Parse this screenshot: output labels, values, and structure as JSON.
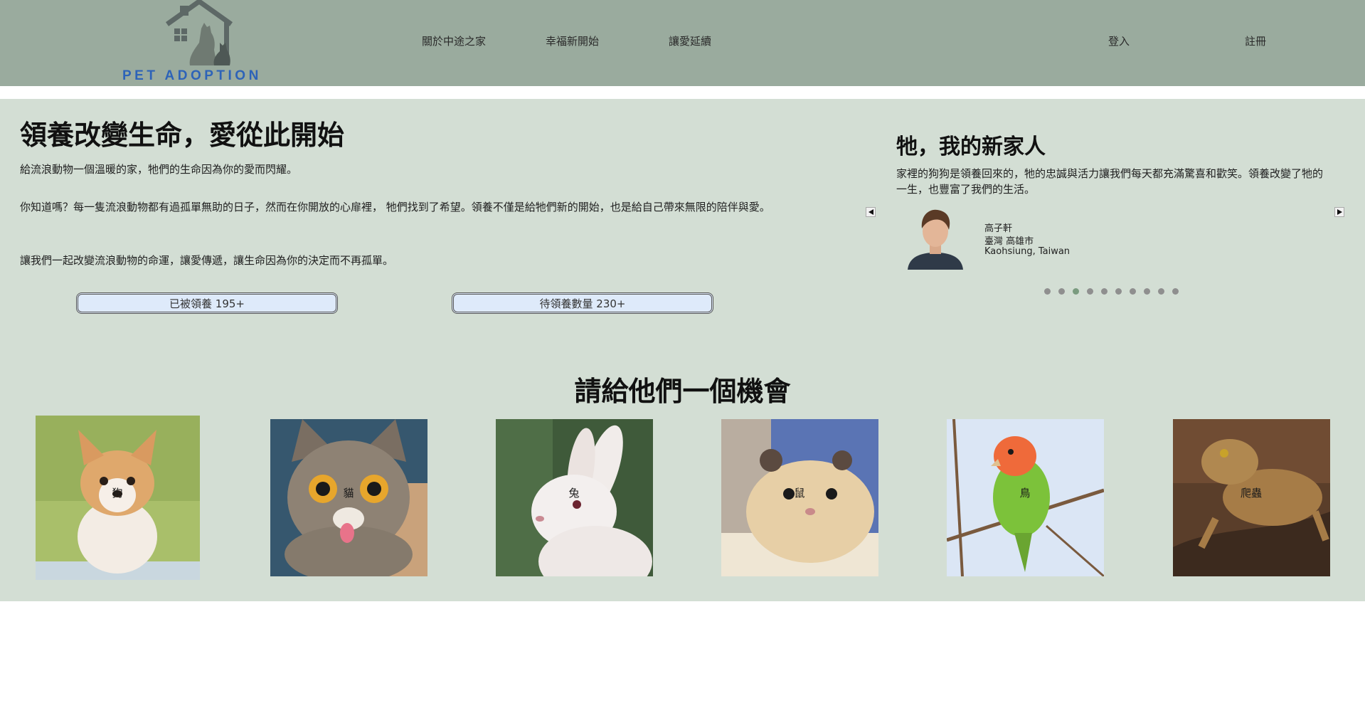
{
  "brand": {
    "logo_text": "PET ADOPTION"
  },
  "nav": {
    "links": [
      "關於中途之家",
      "幸福新開始",
      "讓愛延續"
    ],
    "login": "登入",
    "register": "註冊"
  },
  "hero": {
    "title": "領養改變生命，愛從此開始",
    "p1": "給流浪動物一個溫暖的家，牠們的生命因為你的愛而閃耀。",
    "p2": "你知道嗎？每一隻流浪動物都有過孤單無助的日子，然而在你開放的心扉裡， 牠們找到了希望。領養不僅是給牠們新的開始，也是給自己帶來無限的陪伴與愛。",
    "p3": "讓我們一起改變流浪動物的命運，讓愛傳遞，讓生命因為你的決定而不再孤單。",
    "adopted_label": "已被領養 195+",
    "waiting_label": "待領養數量 230+"
  },
  "testimonial": {
    "title": "牠，我的新家人",
    "text": "家裡的狗狗是領養回來的，牠的忠誠與活力讓我們每天都充滿驚喜和歡笑。領養改變了牠的一生，也豐富了我們的生活。",
    "name": "高子軒",
    "location_zh": "臺灣 高雄市",
    "location_en": "Kaohsiung, Taiwan",
    "dot_count": 10,
    "active_dot": 2
  },
  "animals": {
    "title": "請給他們一個機會",
    "items": [
      {
        "label": "狗"
      },
      {
        "label": "貓"
      },
      {
        "label": "兔"
      },
      {
        "label": "鼠"
      },
      {
        "label": "鳥"
      },
      {
        "label": "爬蟲"
      }
    ]
  },
  "colors": {
    "navbar_bg": "#9aab9e",
    "content_bg": "#d3ded4",
    "logo_blue": "#2d63b8",
    "button_bg": "#deeafa",
    "active_dot": "#7a9b7f"
  }
}
